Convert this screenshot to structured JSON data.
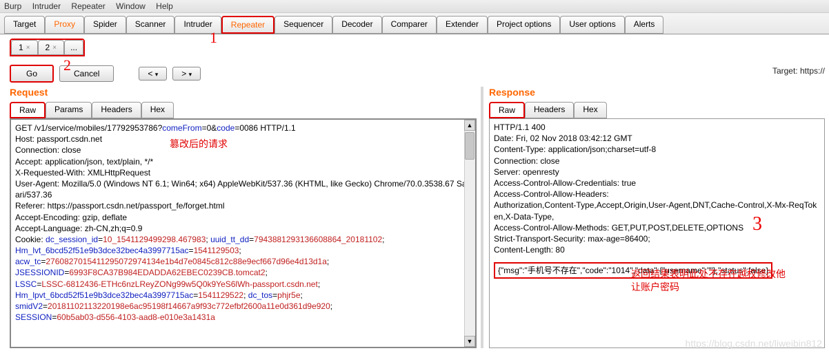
{
  "menubar": [
    "Burp",
    "Intruder",
    "Repeater",
    "Window",
    "Help"
  ],
  "mainTabs": [
    "Target",
    "Proxy",
    "Spider",
    "Scanner",
    "Intruder",
    "Repeater",
    "Sequencer",
    "Decoder",
    "Comparer",
    "Extender",
    "Project options",
    "User options",
    "Alerts"
  ],
  "activeMainTab": "Repeater",
  "repTabs": [
    {
      "label": "1",
      "close": true
    },
    {
      "label": "2",
      "close": true
    },
    {
      "label": "...",
      "close": false
    }
  ],
  "buttons": {
    "go": "Go",
    "cancel": "Cancel",
    "prev": "<",
    "next": ">"
  },
  "targetLabel": "Target: https://",
  "request": {
    "title": "Request",
    "tabs": [
      "Raw",
      "Params",
      "Headers",
      "Hex"
    ],
    "line1_a": "GET /v1/service/mobiles/17792953786?",
    "line1_b": "comeFrom",
    "line1_c": "=0&",
    "line1_d": "code",
    "line1_e": "=0086 HTTP/1.1",
    "host": "Host: passport.csdn.net",
    "conn": "Connection: close",
    "accept": "Accept: application/json, text/plain, */*",
    "xreq": "X-Requested-With: XMLHttpRequest",
    "ua": "User-Agent: Mozilla/5.0 (Windows NT 6.1; Win64; x64) AppleWebKit/537.36 (KHTML, like Gecko) Chrome/70.0.3538.67 Safari/537.36",
    "referer": "Referer: https://passport.csdn.net/passport_fe/forget.html",
    "ae": "Accept-Encoding: gzip, deflate",
    "al": "Accept-Language: zh-CN,zh;q=0.9",
    "c1a": "Cookie: ",
    "c1b": "dc_session_id",
    "c1c": "=",
    "c1d": "10_1541129499298.467983",
    "c1e": "; ",
    "c1f": "uuid_tt_dd",
    "c1g": "=",
    "c1h": "7943881293136608864_20181102",
    "c1i": ";",
    "c2a": "Hm_lvt_6bcd52f51e9b3dce32bec4a3997715ac",
    "c2b": "=",
    "c2c": "1541129503",
    "c2d": ";",
    "c3a": "acw_tc",
    "c3b": "=",
    "c3c": "2760827015411295072974134e1b4d7e0845c812c88e9ecf667d96e4d13d1a",
    "c3d": ";",
    "c4a": "JSESSIONID",
    "c4b": "=",
    "c4c": "6993F8CA37B984EDADDA62EBEC0239CB.tomcat2",
    "c4d": ";",
    "c5a": "LSSC",
    "c5b": "=",
    "c5c": "LSSC-6812436-ETHc6nzLReyZONg99w5Q0k9YeS6lWh-passport.csdn.net",
    "c5d": ";",
    "c6a": "Hm_lpvt_6bcd52f51e9b3dce32bec4a3997715ac",
    "c6b": "=",
    "c6c": "1541129522",
    "c6d": "; ",
    "c6e": "dc_tos",
    "c6f": "=",
    "c6g": "phjr5e",
    "c6h": ";",
    "c7a": "smidV2",
    "c7b": "=",
    "c7c": "20181102113220198e6ac95198f14667a9f93c772efbf2600a11e0d361d9e920",
    "c7d": ";",
    "c8a": "SESSION",
    "c8b": "=",
    "c8c": "60b5ab03-d556-4103-aad8-e010e3a1431a",
    "note": "篡改后的请求"
  },
  "response": {
    "title": "Response",
    "tabs": [
      "Raw",
      "Headers",
      "Hex"
    ],
    "l1": "HTTP/1.1 400",
    "l2": "Date: Fri, 02 Nov 2018 03:42:12 GMT",
    "l3": "Content-Type: application/json;charset=utf-8",
    "l4": "Connection: close",
    "l5": "Server: openresty",
    "l6": "Access-Control-Allow-Credentials: true",
    "l7": "Access-Control-Allow-Headers:",
    "l8": "Authorization,Content-Type,Accept,Origin,User-Agent,DNT,Cache-Control,X-Mx-ReqToken,X-Data-Type,",
    "l9": "Access-Control-Allow-Methods: GET,PUT,POST,DELETE,OPTIONS",
    "l10": "Strict-Transport-Security: max-age=86400;",
    "l11": "Content-Length: 80",
    "json": "{\"msg\":\"手机号不存在\",\"code\":\"1014\",\"data\":{\"username\":\"\"},\"status\":false}",
    "note": "返回结果表明此处不存在越权修改他让账户密码"
  },
  "handNums": {
    "one": "1",
    "two": "2",
    "three": "3"
  },
  "watermark": "https://blog.csdn.net/liweibin812"
}
